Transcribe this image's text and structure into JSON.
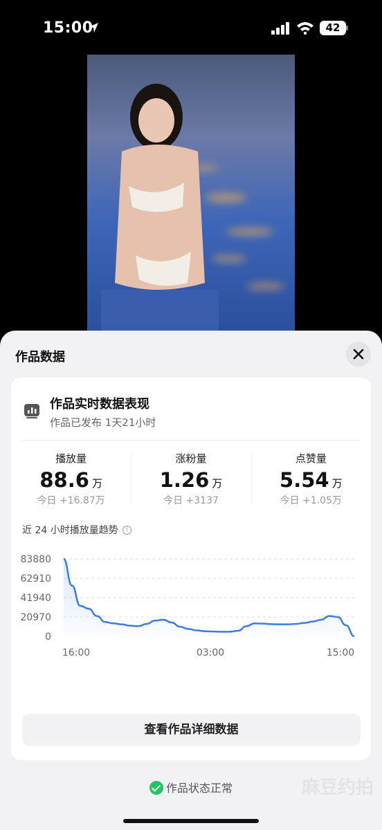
{
  "status_bar": {
    "time": "15:00",
    "battery": "42"
  },
  "sheet": {
    "title": "作品数据"
  },
  "card": {
    "title": "作品实时数据表现",
    "subtitle": "作品已发布 1天21小时",
    "metrics": [
      {
        "label": "播放量",
        "value": "88.6",
        "unit": "万",
        "today": "今日 +16.87万"
      },
      {
        "label": "涨粉量",
        "value": "1.26",
        "unit": "万",
        "today": "今日 +3137"
      },
      {
        "label": "点赞量",
        "value": "5.54",
        "unit": "万",
        "today": "今日 +1.05万"
      }
    ],
    "chart_title": "近 24 小时播放量趋势",
    "detail_button": "查看作品详细数据"
  },
  "chart_data": {
    "type": "area",
    "title": "近 24 小时播放量趋势",
    "yticks": [
      "83880",
      "62910",
      "41940",
      "20970",
      "0"
    ],
    "ytick_values": [
      83880,
      62910,
      41940,
      20970,
      0
    ],
    "xticks": [
      "16:00",
      "03:00",
      "15:00"
    ],
    "ylim": [
      0,
      83880
    ],
    "grid": true,
    "color": "#3b7be8",
    "series": [
      {
        "values": [
          83880,
          55000,
          33000,
          30000,
          22000,
          15500,
          14000,
          13000,
          11500,
          11000,
          13500,
          17000,
          18000,
          15000,
          10500,
          8000,
          6500,
          5500,
          5200,
          5000,
          5000,
          6000,
          11000,
          14000,
          13800,
          13200,
          13000,
          13000,
          13500,
          14500,
          16000,
          18000,
          22000,
          21000,
          12000,
          0
        ]
      }
    ]
  },
  "footer": {
    "status": "作品状态正常",
    "watermark": "麻豆约拍"
  }
}
